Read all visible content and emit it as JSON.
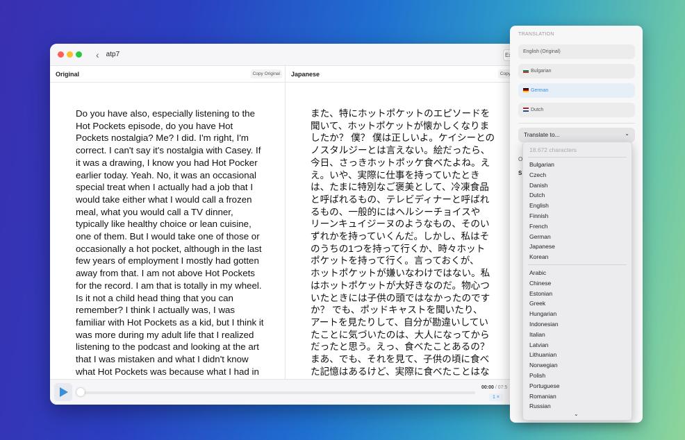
{
  "window": {
    "title": "atp7",
    "export_label": "Ex"
  },
  "columns": {
    "original": {
      "title": "Original",
      "copy_label": "Copy Original"
    },
    "translation": {
      "title": "Japanese",
      "copy_label": "Copy Translatio"
    }
  },
  "original_lines": [
    "Do you have also, especially listening to the",
    "Hot Pockets episode, do you have Hot",
    "Pockets nostalgia? Me? I did. I'm right, I'm",
    "correct. I can't say it's nostalgia with Casey. If",
    "it was a drawing, I know you had Hot Pocker",
    "earlier today. Yeah. No, it was an occasional",
    "special treat when I actually had a job that I",
    "would take either what I would call a frozen",
    "meal, what you would call a TV dinner,",
    "typically like healthy choice or lean cuisine,",
    "one of them. But I would take one of those or",
    "occasionally a hot pocket, although in the last",
    "few years of employment I mostly had gotten",
    "away from that. I am not above Hot Pockets",
    "for the record. I am that is totally in my wheel.",
    "Is it not a child head thing that you can",
    "remember? I think I actually was, I was",
    "familiar with Hot Pockets as a kid, but I think it",
    "was more during my adult life that I realized",
    "listening to the podcast and looking at the art",
    "that I was mistaken and what I didn't know",
    "what Hot Pockets was because what I had in"
  ],
  "translation_lines": [
    "また、特にホットポケットのエピソードを",
    "聞いて、ホットポケットが懐かしくなりま",
    "したか？ 僕？ 僕は正しいよ。ケイシーとの",
    "ノスタルジーとは言えない。絵だったら、",
    "今日、さっきホットポッケ食べたよね。え",
    "え。いや、実際に仕事を持っていたとき",
    "は、たまに特別なご褒美として、冷凍食品",
    "と呼ばれるもの、テレビディナーと呼ばれ",
    "るもの、一般的にはヘルシーチョイスや",
    "リーンキュイジーヌのようなもの、そのい",
    "ずれかを持っていくんだ。しかし、私はそ",
    "のうちの1つを持って行くか、時々ホット",
    "ポケットを持って行く。言っておくが、",
    "ホットポケットが嫌いなわけではない。私",
    "はホットポケットが大好きなのだ。物心つ",
    "いたときには子供の頭ではなかったのです",
    "か？ でも、ポッドキャストを聞いたり、",
    "アートを見たりして、自分が勘違いしてい",
    "たことに気づいたのは、大人になってから",
    "だったと思う。えっ、食べたことあるの？",
    "まあ、でも、それを見て、子供の頃に食べ",
    "た記憶はあるけど、実際に食べたことはな"
  ],
  "player": {
    "current": "00:00",
    "total": "/ 07:5",
    "speed": "1 ×",
    "progress": 0
  },
  "panel": {
    "title": "TRANSLATION",
    "languages": [
      {
        "label": "English (Original)"
      },
      {
        "label": "Bulgarian"
      },
      {
        "label": "German",
        "selected": true
      },
      {
        "label": "Dutch"
      }
    ],
    "translate_to": "Translate to...",
    "peek_o": "O",
    "peek_s": "S"
  },
  "dropdown": {
    "count": "18.672 characters",
    "group1": [
      "Bulgarian",
      "Czech",
      "Danish",
      "Dutch",
      "English",
      "Finnish",
      "French",
      "German",
      "Japanese",
      "Korean"
    ],
    "group2": [
      "Arabic",
      "Chinese",
      "Estonian",
      "Greek",
      "Hungarian",
      "Indonesian",
      "Italian",
      "Latvian",
      "Lithuanian",
      "Norwegian",
      "Polish",
      "Portuguese",
      "Romanian",
      "Russian"
    ]
  },
  "colors": {
    "accent": "#3a8fd8"
  }
}
